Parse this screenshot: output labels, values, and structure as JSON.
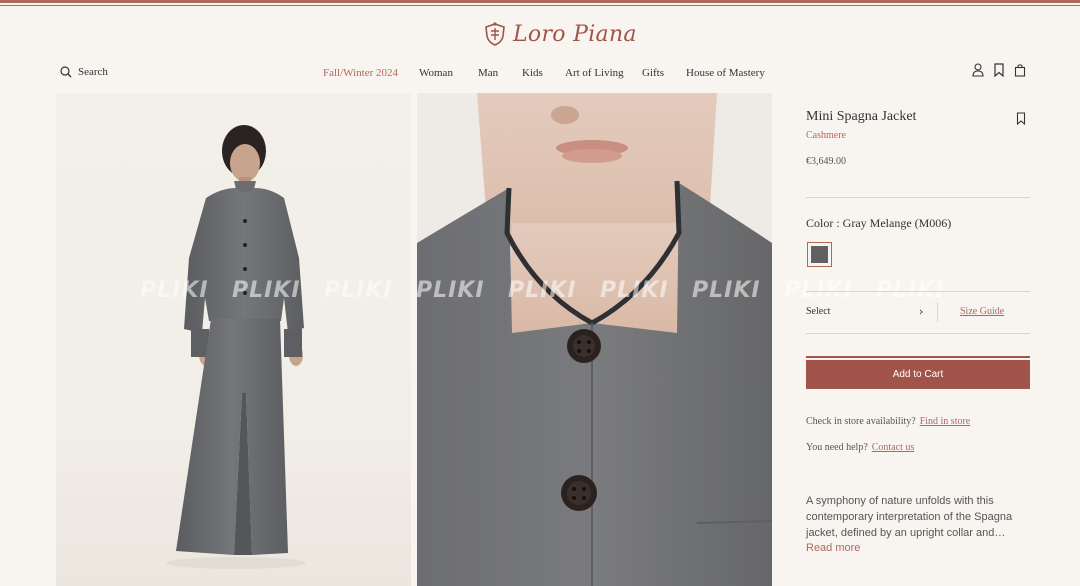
{
  "brand": {
    "name": "Loro Piana",
    "accent": "#b2675d"
  },
  "header": {
    "search_label": "Search",
    "nav": [
      "Fall/Winter 2024",
      "Woman",
      "Man",
      "Kids",
      "Art of Living",
      "Gifts",
      "House of Mastery"
    ],
    "icons": [
      "user-icon",
      "bookmark-icon",
      "bag-icon"
    ]
  },
  "gallery": {
    "watermark": [
      "PLIKI",
      "PLIKI",
      "PLIKI",
      "PLIKI",
      "PLIKI",
      "PLIKI",
      "PLIKI",
      "PLIKI",
      "PLIKI"
    ]
  },
  "product": {
    "title": "Mini Spagna Jacket",
    "material": "Cashmere",
    "price": "€3,649.00",
    "color_label": "Color : Gray Melange (M006)",
    "swatch_color": "#5f6163",
    "size_select": "Select",
    "size_guide": "Size Guide",
    "add_to_cart": "Add to Cart",
    "store_question": "Check in store availability?",
    "store_link": "Find in store",
    "help_question": "You need help?",
    "help_link": "Contact us",
    "description": "A symphony of nature unfolds with this contemporary interpretation of the Spagna jacket, defined by an upright collar and…",
    "read_more": "Read more"
  }
}
